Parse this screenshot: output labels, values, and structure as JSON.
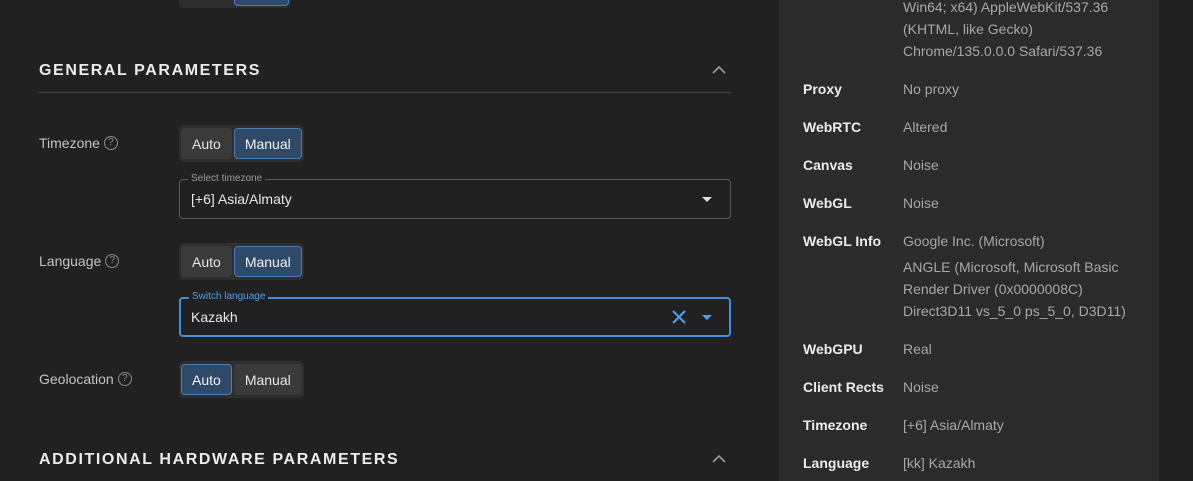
{
  "general": {
    "title": "GENERAL PARAMETERS",
    "timezone": {
      "label": "Timezone",
      "help": "?",
      "mode_auto": "Auto",
      "mode_manual": "Manual",
      "select_label": "Select timezone",
      "select_value": "[+6] Asia/Almaty"
    },
    "language": {
      "label": "Language",
      "help": "?",
      "mode_auto": "Auto",
      "mode_manual": "Manual",
      "select_label": "Switch language",
      "select_value": "Kazakh"
    },
    "geolocation": {
      "label": "Geolocation",
      "help": "?",
      "mode_auto": "Auto",
      "mode_manual": "Manual"
    }
  },
  "additional": {
    "title": "ADDITIONAL HARDWARE PARAMETERS"
  },
  "summary": {
    "ua_line1": "Win64; x64) AppleWebKit/537.36",
    "ua_line2": "(KHTML, like Gecko)",
    "ua_line3": "Chrome/135.0.0.0 Safari/537.36",
    "rows": [
      {
        "key": "Proxy",
        "value": "No proxy"
      },
      {
        "key": "WebRTC",
        "value": "Altered"
      },
      {
        "key": "Canvas",
        "value": "Noise"
      },
      {
        "key": "WebGL",
        "value": "Noise"
      },
      {
        "key": "WebGL Info",
        "value": "Google Inc. (Microsoft)"
      },
      {
        "key": "WebGPU",
        "value": "Real"
      },
      {
        "key": "Client Rects",
        "value": "Noise"
      },
      {
        "key": "Timezone",
        "value": "[+6] Asia/Almaty"
      },
      {
        "key": "Language",
        "value": "[kk] Kazakh"
      }
    ],
    "webgl_renderer_line1": "ANGLE (Microsoft, Microsoft Basic",
    "webgl_renderer_line2": "Render Driver (0x0000008C)",
    "webgl_renderer_line3": "Direct3D11 vs_5_0 ps_5_0, D3D11)"
  },
  "colors": {
    "accent": "#3f8fdc",
    "active_toggle_bg": "#2f4a68",
    "panel_bg": "#2b2b2b",
    "page_bg": "#212121"
  },
  "state": {
    "timezone_mode": "Manual",
    "language_mode": "Manual",
    "geolocation_mode": "Auto"
  }
}
